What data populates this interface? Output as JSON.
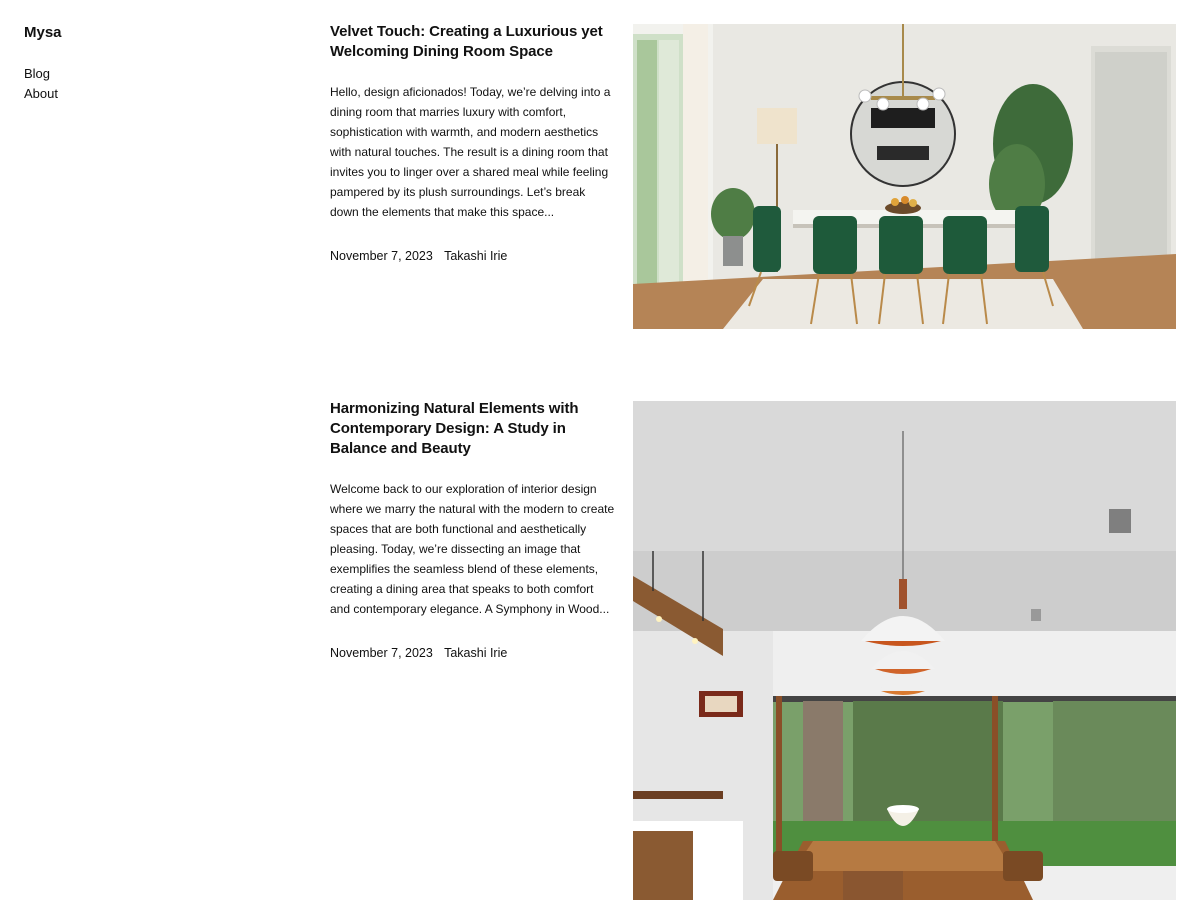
{
  "site": {
    "title": "Mysa"
  },
  "nav": {
    "items": [
      {
        "label": "Blog"
      },
      {
        "label": "About"
      }
    ]
  },
  "posts": [
    {
      "title": "Velvet Touch: Creating a Luxurious yet Welcoming Dining Room Space",
      "excerpt": "Hello, design aficionados! Today, we’re delving into a dining room that marries luxury with comfort, sophistication with warmth, and modern aesthetics with natural touches. The result is a dining room that invites you to linger over a shared meal while feeling pampered by its plush surroundings. Let’s break down the elements that make this space...",
      "date": "November 7, 2023",
      "author": "Takashi Irie"
    },
    {
      "title": "Harmonizing Natural Elements with Contemporary Design: A Study in Balance and Beauty",
      "excerpt": "Welcome back to our exploration of interior design where we marry the natural with the modern to create spaces that are both functional and aesthetically pleasing. Today, we’re dissecting an image that exemplifies the seamless blend of these elements, creating a dining area that speaks to both comfort and contemporary elegance. A Symphony in Wood...",
      "date": "November 7, 2023",
      "author": "Takashi Irie"
    }
  ]
}
